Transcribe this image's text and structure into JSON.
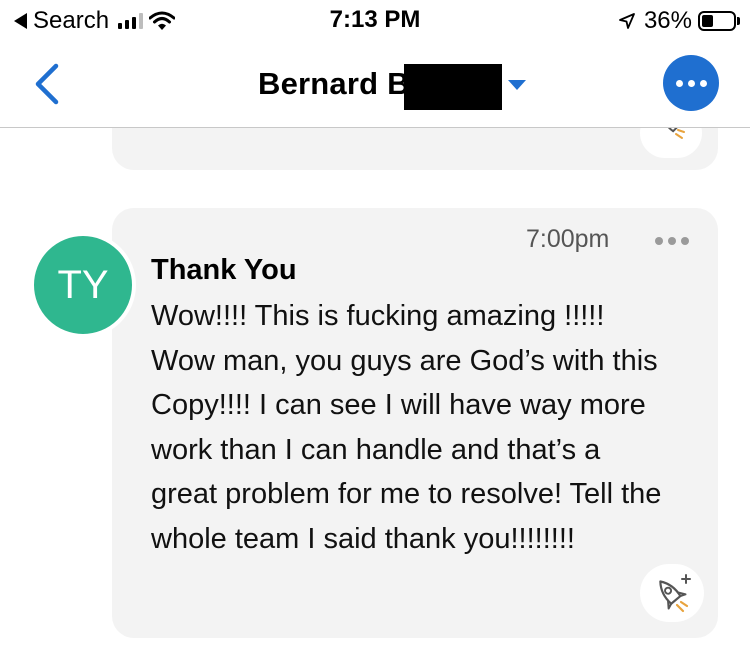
{
  "status_bar": {
    "back_app": "Search",
    "time": "7:13 PM",
    "battery_percent": "36%",
    "battery_level": 0.36
  },
  "nav": {
    "title": "Bernard B",
    "accent_color": "#1f6fd0"
  },
  "message": {
    "avatar_initials": "TY",
    "avatar_color": "#2fb78f",
    "time": "7:00pm",
    "subject": "Thank You",
    "body": "Wow!!!! This is fucking amazing !!!!! Wow man, you guys are God’s with this Copy!!!! I can see I will have way more work than I can handle and that’s a great problem for me to resolve! Tell the whole team I said thank you!!!!!!!!"
  },
  "icons": {
    "back": "chevron-left-icon",
    "more": "more-horizontal-icon",
    "boost": "rocket-plus-icon",
    "location": "location-arrow-icon"
  }
}
